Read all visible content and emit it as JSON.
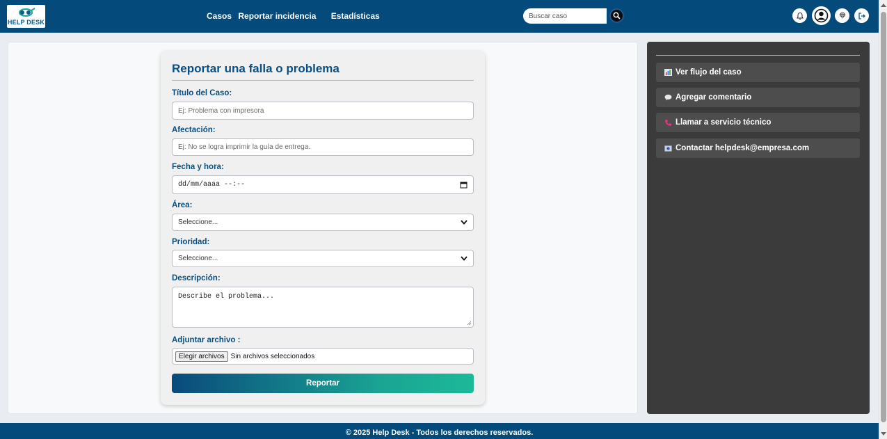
{
  "header": {
    "logo_text": "HELP DESK",
    "nav": [
      "Casos",
      "Reportar incidencia",
      "Estadísticas"
    ],
    "search_placeholder": "Buscar caso"
  },
  "form": {
    "title": "Reportar una falla o problema",
    "fields": {
      "titulo": {
        "label": "Título del Caso:",
        "placeholder": "Ej: Problema con impresora"
      },
      "afectacion": {
        "label": "Afectación:",
        "placeholder": "Ej: No se logra imprimir la guía de entrega."
      },
      "fecha": {
        "label": "Fecha y hora:",
        "value": "dd/mm/aaaa --:--"
      },
      "area": {
        "label": "Área:",
        "selected": "Seleccione..."
      },
      "prioridad": {
        "label": "Prioridad:",
        "selected": "Seleccione..."
      },
      "descripcion": {
        "label": "Descripción:",
        "placeholder": "Describe el problema..."
      },
      "archivo": {
        "label": "Adjuntar archivo :",
        "button": "Elegir archivos",
        "status": "Sin archivos seleccionados"
      }
    },
    "submit": "Reportar"
  },
  "side": {
    "actions": [
      {
        "label": "Ver flujo del caso",
        "icon": "chart-icon"
      },
      {
        "label": "Agregar comentario",
        "icon": "speech-bubble-icon"
      },
      {
        "label": "Llamar a servicio técnico",
        "icon": "phone-icon"
      },
      {
        "label": "Contactar helpdesk@empresa.com",
        "icon": "email-icon"
      }
    ]
  },
  "footer": {
    "text": "© 2025 Help Desk - Todos los derechos reservados."
  },
  "colors": {
    "navbar": "#044a7a",
    "accent": "#1db999",
    "side_panel": "#3b3b3b"
  }
}
